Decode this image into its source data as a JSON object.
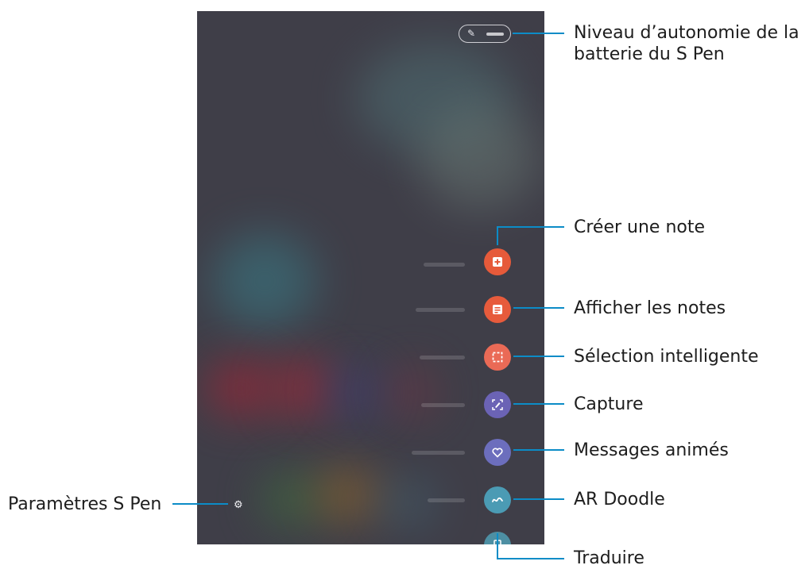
{
  "callouts": {
    "battery_line1": "Niveau d’autonomie de la",
    "battery_line2": "batterie du S Pen",
    "create_note": "Créer une note",
    "view_notes": "Afficher les notes",
    "smart_select": "Sélection intelligente",
    "capture": "Capture",
    "live_messages": "Messages animés",
    "ar_doodle": "AR Doodle",
    "translate": "Traduire",
    "settings": "Paramètres S Pen"
  },
  "icons": {
    "pen": "pen-icon",
    "create_note": "plus-note-icon",
    "view_notes": "notes-icon",
    "smart_select": "crop-select-icon",
    "capture": "screen-write-icon",
    "live_messages": "heart-icon",
    "ar_doodle": "doodle-icon",
    "translate": "translate-icon",
    "settings": "gear-icon"
  },
  "colors": {
    "create_note": "#e65a3a",
    "view_notes": "#e75b3c",
    "smart_select": "#ea6a56",
    "capture": "#6b63b5",
    "live_messages": "#6c6ebd",
    "ar_doodle": "#4b9bb4",
    "translate": "#4d8fa3",
    "callout_line": "#0c8cc7"
  }
}
